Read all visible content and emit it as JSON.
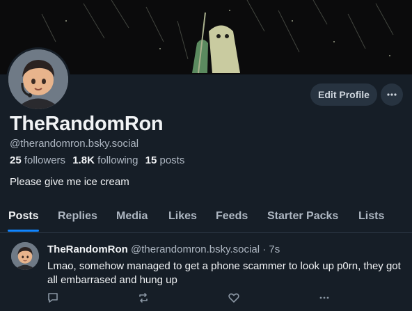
{
  "profile": {
    "display_name": "TheRandomRon",
    "handle": "@therandomron.bsky.social",
    "followers_count": "25",
    "followers_label": "followers",
    "following_count": "1.8K",
    "following_label": "following",
    "posts_count": "15",
    "posts_label": "posts",
    "bio": "Please give me ice cream"
  },
  "actions": {
    "edit_profile_label": "Edit Profile",
    "more_icon": "ellipsis-icon"
  },
  "tabs": [
    {
      "label": "Posts",
      "active": true
    },
    {
      "label": "Replies"
    },
    {
      "label": "Media"
    },
    {
      "label": "Likes"
    },
    {
      "label": "Feeds"
    },
    {
      "label": "Starter Packs"
    },
    {
      "label": "Lists"
    }
  ],
  "post": {
    "author": "TheRandomRon",
    "handle": "@therandomron.bsky.social",
    "separator": "·",
    "time": "7s",
    "text": "Lmao, somehow managed to get a phone scammer to look up p0rn, they got all embarrased and hung up",
    "icons": [
      "reply-icon",
      "repost-icon",
      "like-icon",
      "more-icon"
    ]
  },
  "colors": {
    "background": "#161e27",
    "accent": "#1185fe",
    "muted_text": "#aeb7c2",
    "button_bg": "#273340"
  }
}
